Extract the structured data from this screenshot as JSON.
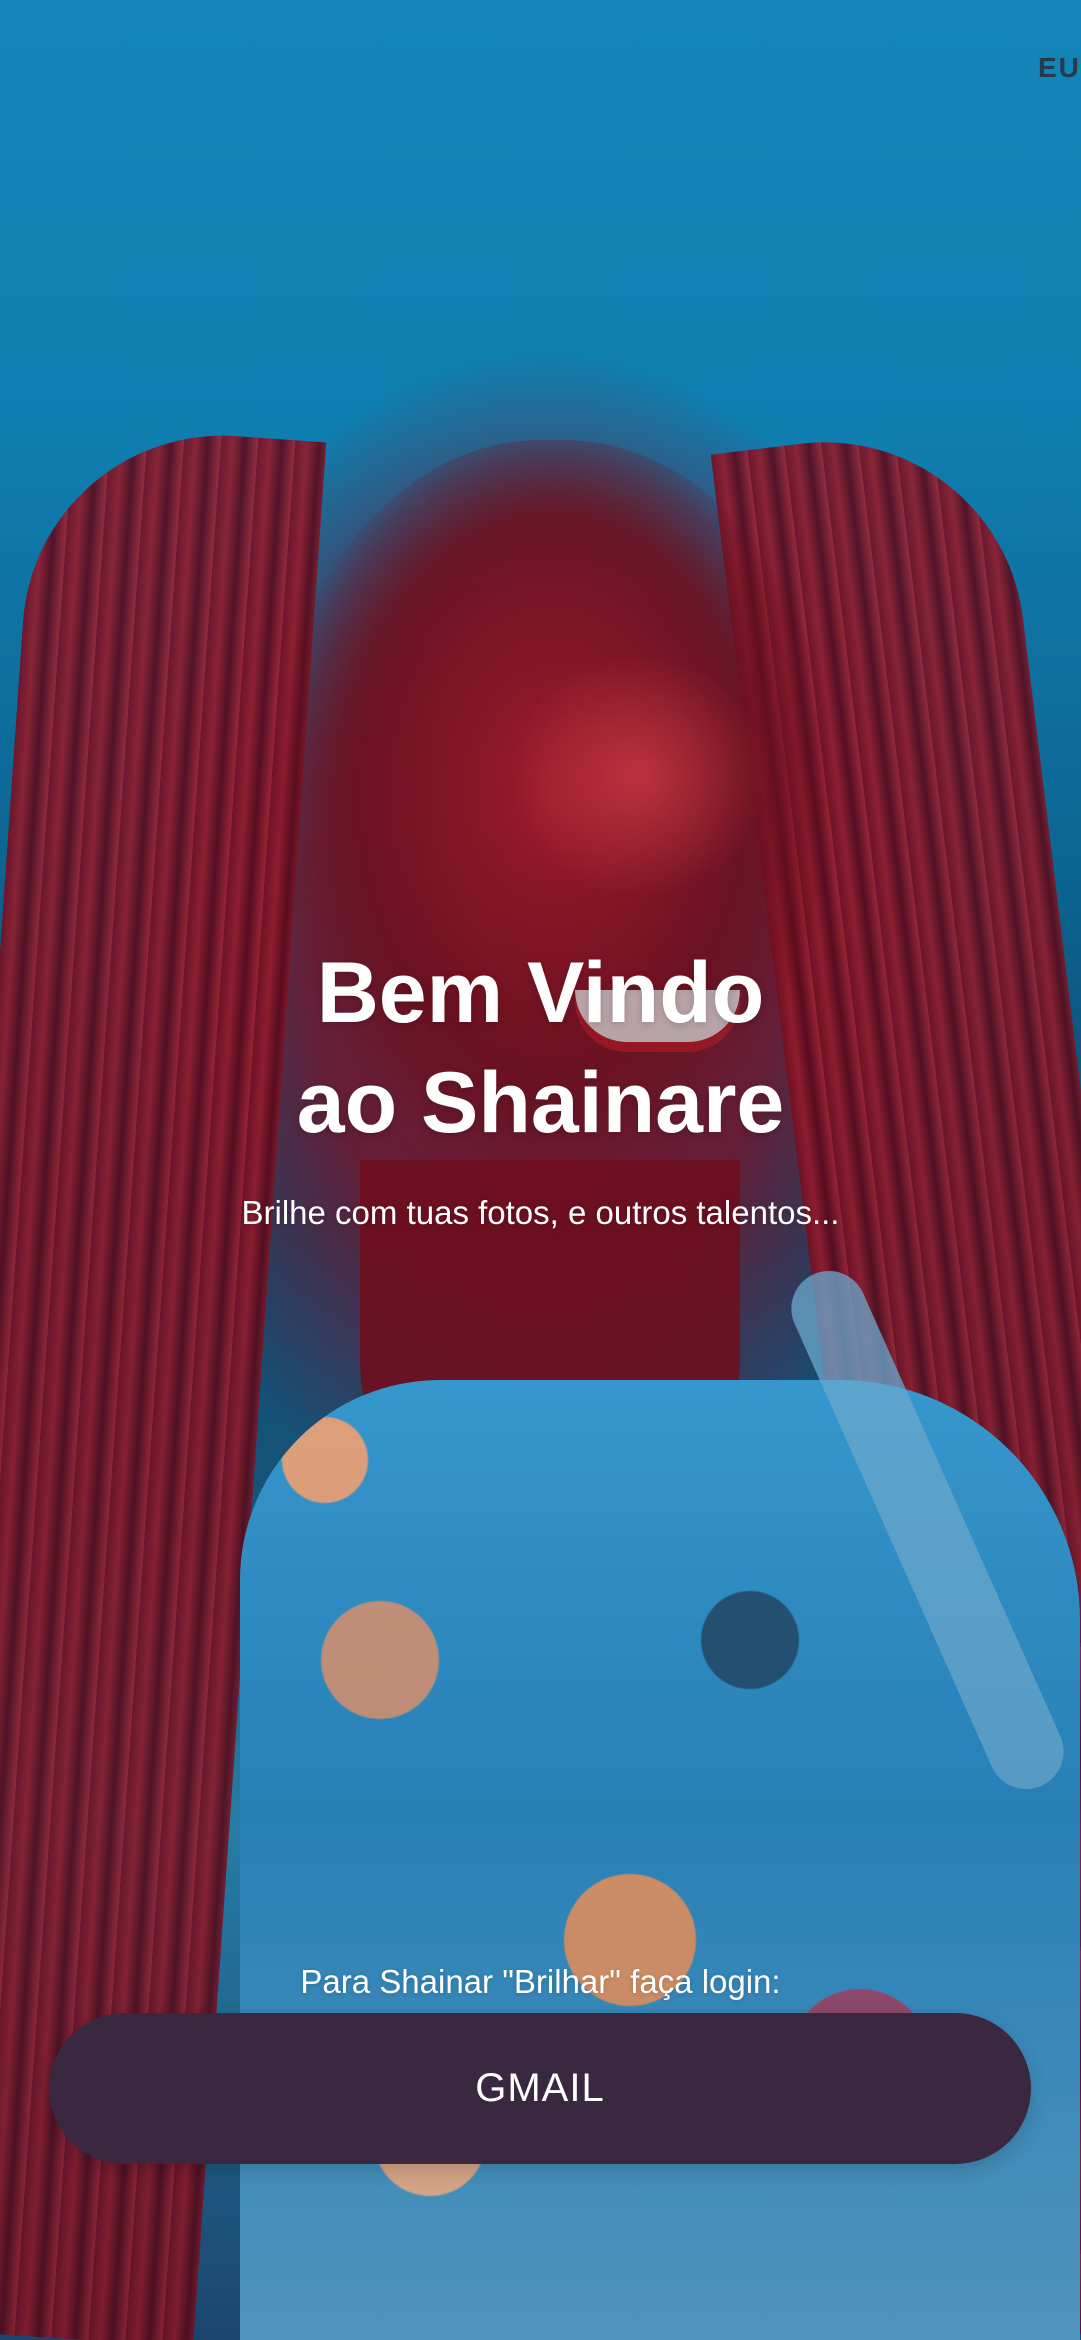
{
  "app": {
    "top_logo": "EU",
    "title_line_1": "Bem Vindo",
    "title_line_2": "ao Shainare",
    "subtitle": "Brilhe com tuas fotos, e outros talentos...",
    "login_prompt": "Para Shainar \"Brilhar\" faça login:",
    "gmail_button": "GMAIL"
  },
  "colors": {
    "button_background": "#3a2740",
    "text": "#ffffff"
  },
  "background": {
    "image_subject": "smiling woman with red braids and floral blouse",
    "icon": "photo-background"
  }
}
